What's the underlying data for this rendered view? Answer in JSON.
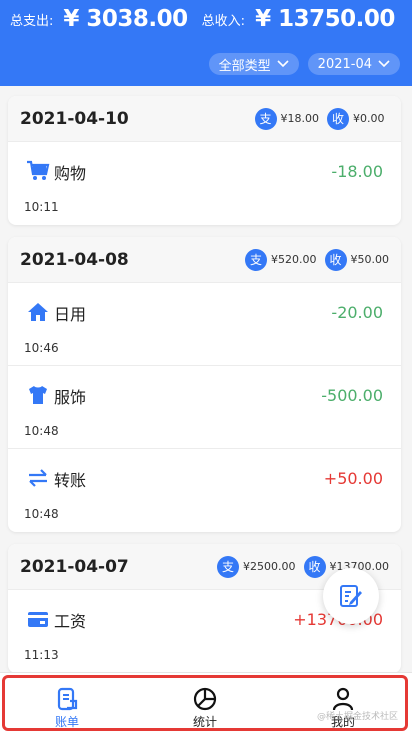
{
  "header": {
    "expense_label": "总支出:",
    "expense_value": "¥ 3038.00",
    "income_label": "总收入:",
    "income_value": "¥ 13750.00",
    "type_filter": "全部类型",
    "month_filter": "2021-04",
    "accent_color": "#3478f6"
  },
  "days": [
    {
      "date": "2021-04-10",
      "expense_badge": "支",
      "expense": "¥18.00",
      "income_badge": "收",
      "income": "¥0.00",
      "items": [
        {
          "icon": "cart-icon",
          "name": "购物",
          "amount": "-18.00",
          "time": "10:11"
        }
      ]
    },
    {
      "date": "2021-04-08",
      "expense_badge": "支",
      "expense": "¥520.00",
      "income_badge": "收",
      "income": "¥50.00",
      "items": [
        {
          "icon": "home-icon",
          "name": "日用",
          "amount": "-20.00",
          "time": "10:46"
        },
        {
          "icon": "shirt-icon",
          "name": "服饰",
          "amount": "-500.00",
          "time": "10:48"
        },
        {
          "icon": "transfer-icon",
          "name": "转账",
          "amount": "+50.00",
          "time": "10:48"
        }
      ]
    },
    {
      "date": "2021-04-07",
      "expense_badge": "支",
      "expense": "¥2500.00",
      "income_badge": "收",
      "income": "¥13700.00",
      "items": [
        {
          "icon": "wallet-icon",
          "name": "工资",
          "amount": "+13700.00",
          "time": "11:13"
        }
      ]
    }
  ],
  "fab": {
    "icon": "edit-icon"
  },
  "tabs": [
    {
      "label": "账单",
      "icon": "bill-icon",
      "active": true
    },
    {
      "label": "统计",
      "icon": "pie-chart-icon",
      "active": false
    },
    {
      "label": "我的",
      "icon": "user-icon",
      "active": false
    }
  ],
  "watermark": "@稀土掘金技术社区",
  "colors": {
    "expense": "#4cae6b",
    "income": "#e53935",
    "highlight_border": "#e53935"
  }
}
